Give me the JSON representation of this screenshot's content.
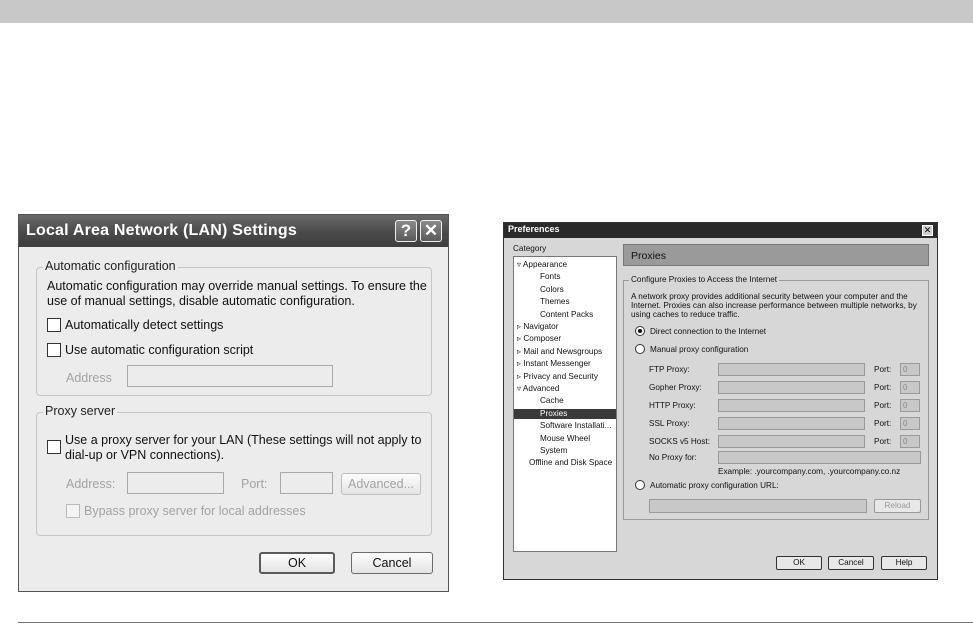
{
  "lan": {
    "title": "Local Area Network (LAN) Settings",
    "help_label": "?",
    "close_label": "✕",
    "auto_config": {
      "legend": "Automatic configuration",
      "description_line1": "Automatic configuration may override manual settings.  To ensure the",
      "description_line2": "use of manual settings, disable automatic configuration.",
      "detect_label": "Automatically detect settings",
      "detect_checked": false,
      "script_label": "Use automatic configuration script",
      "script_checked": false,
      "address_label": "Address",
      "address_value": ""
    },
    "proxy": {
      "legend": "Proxy server",
      "use_proxy_line1": "Use a proxy server for your LAN (These settings will not apply to",
      "use_proxy_line2": "dial-up or VPN connections).",
      "use_proxy_checked": false,
      "address_label": "Address:",
      "address_value": "",
      "port_label": "Port:",
      "port_value": "",
      "advanced_label": "Advanced...",
      "bypass_label": "Bypass proxy server for local addresses",
      "bypass_checked": false
    },
    "ok_label": "OK",
    "cancel_label": "Cancel"
  },
  "prefs": {
    "title": "Preferences",
    "close_label": "✕",
    "category_label": "Category",
    "tree": [
      {
        "label": "▿ Appearance",
        "indent": 0
      },
      {
        "label": "Fonts",
        "indent": 2
      },
      {
        "label": "Colors",
        "indent": 2
      },
      {
        "label": "Themes",
        "indent": 2
      },
      {
        "label": "Content Packs",
        "indent": 2
      },
      {
        "label": "▹ Navigator",
        "indent": 0
      },
      {
        "label": "▹ Composer",
        "indent": 0
      },
      {
        "label": "▹ Mail and Newsgroups",
        "indent": 0
      },
      {
        "label": "▹ Instant Messenger",
        "indent": 0
      },
      {
        "label": "▹ Privacy and Security",
        "indent": 0
      },
      {
        "label": "▿ Advanced",
        "indent": 0
      },
      {
        "label": "Cache",
        "indent": 2
      },
      {
        "label": "Proxies",
        "indent": 2,
        "selected": true
      },
      {
        "label": "Software Installati...",
        "indent": 2
      },
      {
        "label": "Mouse Wheel",
        "indent": 2
      },
      {
        "label": "System",
        "indent": 2
      },
      {
        "label": "Offline and Disk Space",
        "indent": 1
      }
    ],
    "pane_title": "Proxies",
    "group_legend": "Configure Proxies to Access the Internet",
    "desc_line1": "A network proxy provides additional security between your computer and the",
    "desc_line2": "Internet. Proxies can also increase performance between multiple networks, by",
    "desc_line3": "using caches to reduce traffic.",
    "direct_label": "Direct connection to the Internet",
    "manual_label": "Manual proxy configuration",
    "selected_mode": "direct",
    "proxies": [
      {
        "label": "FTP Proxy:",
        "port_label": "Port:",
        "port_value": "0"
      },
      {
        "label": "Gopher Proxy:",
        "port_label": "Port:",
        "port_value": "0"
      },
      {
        "label": "HTTP Proxy:",
        "port_label": "Port:",
        "port_value": "0"
      },
      {
        "label": "SSL Proxy:",
        "port_label": "Port:",
        "port_value": "0"
      },
      {
        "label": "SOCKS v5 Host:",
        "port_label": "Port:",
        "port_value": "0"
      }
    ],
    "no_proxy_label": "No Proxy for:",
    "no_proxy_value": "",
    "example_text": "Example: .yourcompany.com, .yourcompany.co.nz",
    "auto_url_label": "Automatic proxy configuration URL:",
    "auto_url_value": "",
    "reload_label": "Reload",
    "ok_label": "OK",
    "cancel_label": "Cancel",
    "help_label": "Help"
  }
}
